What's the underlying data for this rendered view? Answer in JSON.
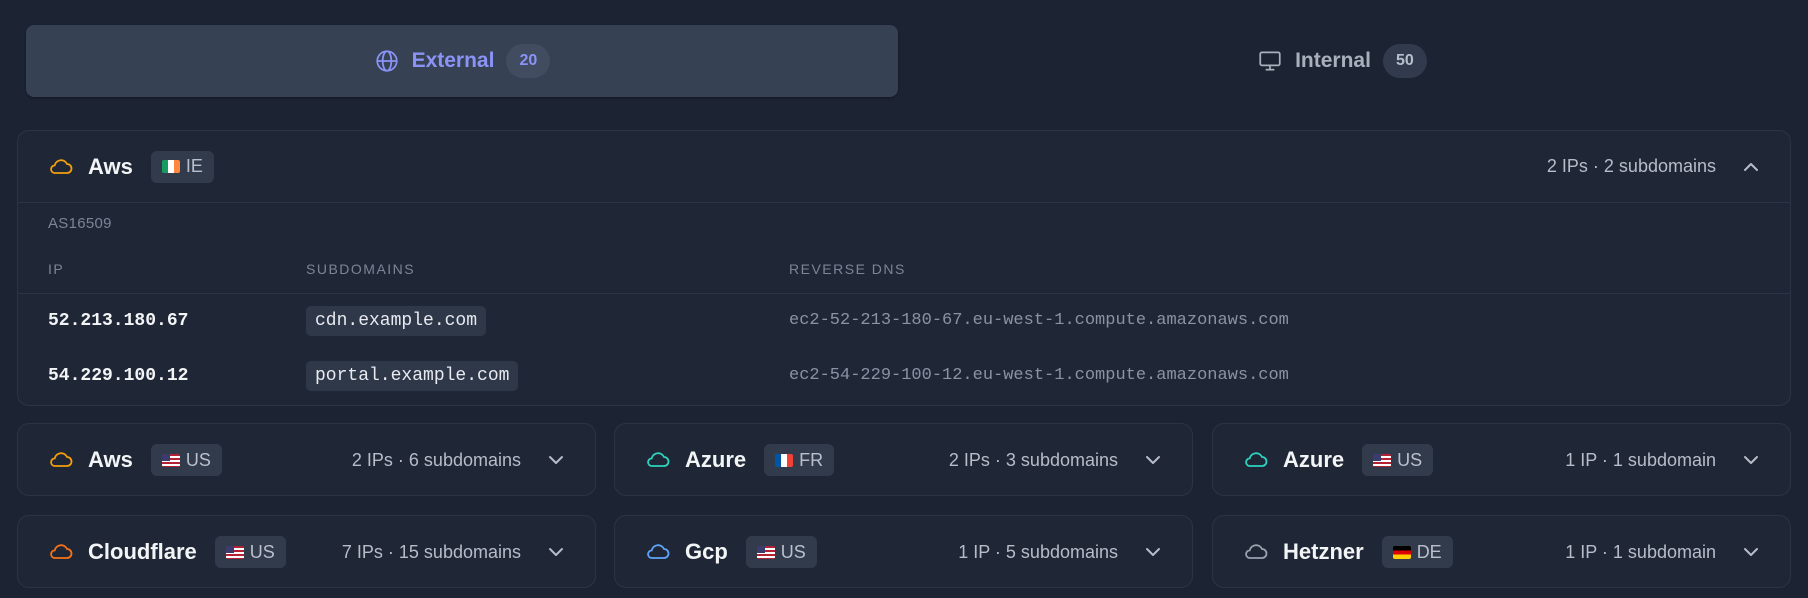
{
  "tabs": [
    {
      "label": "External",
      "count": "20",
      "icon": "globe-icon",
      "active": true
    },
    {
      "label": "Internal",
      "count": "50",
      "icon": "monitor-icon",
      "active": false
    }
  ],
  "expanded": {
    "provider": "Aws",
    "country": "IE",
    "stats": "2 IPs · 2 subdomains",
    "asn": "AS16509",
    "columns": [
      "IP",
      "SUBDOMAINS",
      "REVERSE DNS"
    ],
    "rows": [
      {
        "ip": "52.213.180.67",
        "subdomain": "cdn.example.com",
        "rdns": "ec2-52-213-180-67.eu-west-1.compute.amazonaws.com"
      },
      {
        "ip": "54.229.100.12",
        "subdomain": "portal.example.com",
        "rdns": "ec2-54-229-100-12.eu-west-1.compute.amazonaws.com"
      }
    ]
  },
  "cards": [
    {
      "provider": "Aws",
      "country": "US",
      "stats": "2 IPs · 6 subdomains",
      "cloud_color": "#f59e0b"
    },
    {
      "provider": "Azure",
      "country": "FR",
      "stats": "2 IPs · 3 subdomains",
      "cloud_color": "#2dd4bf"
    },
    {
      "provider": "Azure",
      "country": "US",
      "stats": "1 IP · 1 subdomain",
      "cloud_color": "#2dd4bf"
    },
    {
      "provider": "Cloudflare",
      "country": "US",
      "stats": "7 IPs · 15 subdomains",
      "cloud_color": "#f97316"
    },
    {
      "provider": "Gcp",
      "country": "US",
      "stats": "1 IP · 5 subdomains",
      "cloud_color": "#60a5fa"
    },
    {
      "provider": "Hetzner",
      "country": "DE",
      "stats": "1 IP · 1 subdomain",
      "cloud_color": "#9ca3af"
    }
  ],
  "colors": {
    "aws": "#f59e0b",
    "accent": "#8b93f6"
  }
}
